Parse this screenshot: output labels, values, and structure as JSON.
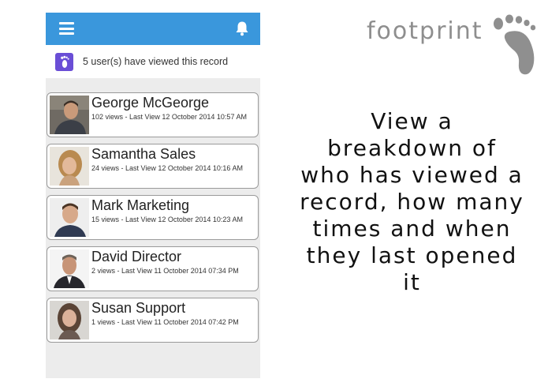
{
  "header": {
    "menu_icon": "hamburger-menu-icon",
    "notification_icon": "bell-icon",
    "bar_color": "#3a97dc"
  },
  "viewed_summary": {
    "icon": "footprint-badge-icon",
    "badge_color": "#6a4ed6",
    "text": "5 user(s) have viewed this record"
  },
  "viewers": [
    {
      "name": "George McGeorge",
      "meta": "102 views - Last View 12 October 2014 10:57 AM"
    },
    {
      "name": "Samantha Sales",
      "meta": "24 views - Last View 12 October 2014 10:16 AM"
    },
    {
      "name": "Mark Marketing",
      "meta": "15 views - Last View 12 October 2014 10:23 AM"
    },
    {
      "name": "David Director",
      "meta": "2 views - Last View 11 October 2014 07:34 PM"
    },
    {
      "name": "Susan Support",
      "meta": "1 views - Last View 11 October 2014 07:42 PM"
    }
  ],
  "brand": {
    "name": "footprint",
    "logo_icon": "footprint-logo-icon"
  },
  "tagline": "View a breakdown of who has viewed a record, how many times and when they last opened it"
}
